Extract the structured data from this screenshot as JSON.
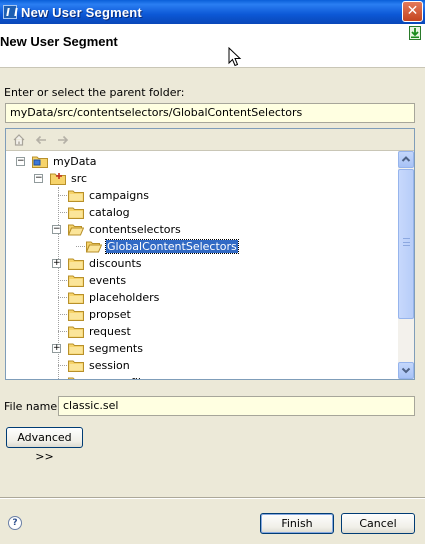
{
  "window": {
    "title": "New User Segment"
  },
  "banner": {
    "heading": "New User Segment"
  },
  "parent_folder": {
    "label": "Enter or select the parent folder:",
    "value": "myData/src/contentselectors/GlobalContentSelectors"
  },
  "tree": {
    "toolbar_icons": [
      "home-icon",
      "back-arrow-icon",
      "forward-arrow-icon"
    ],
    "items": [
      {
        "label": "myData",
        "level": 0,
        "expander": "-"
      },
      {
        "label": "src",
        "level": 1,
        "expander": "-"
      },
      {
        "label": "campaigns",
        "level": 2,
        "expander": ""
      },
      {
        "label": "catalog",
        "level": 2,
        "expander": ""
      },
      {
        "label": "contentselectors",
        "level": 2,
        "expander": "-"
      },
      {
        "label": "GlobalContentSelectors",
        "level": 3,
        "expander": "",
        "selected": true
      },
      {
        "label": "discounts",
        "level": 2,
        "expander": "+"
      },
      {
        "label": "events",
        "level": 2,
        "expander": ""
      },
      {
        "label": "placeholders",
        "level": 2,
        "expander": ""
      },
      {
        "label": "propset",
        "level": 2,
        "expander": ""
      },
      {
        "label": "request",
        "level": 2,
        "expander": ""
      },
      {
        "label": "segments",
        "level": 2,
        "expander": "+"
      },
      {
        "label": "session",
        "level": 2,
        "expander": ""
      },
      {
        "label": "userprofiles",
        "level": 2,
        "expander": ""
      }
    ]
  },
  "file_name": {
    "label": "File name:",
    "value": "classic.sel"
  },
  "buttons": {
    "advanced": "Advanced >>",
    "finish": "Finish",
    "cancel": "Cancel"
  },
  "colors": {
    "selection": "#316ac5",
    "field_bg": "#ffffe1",
    "dialog_bg": "#ece9d8",
    "titlebar": "#0a5fd8"
  }
}
